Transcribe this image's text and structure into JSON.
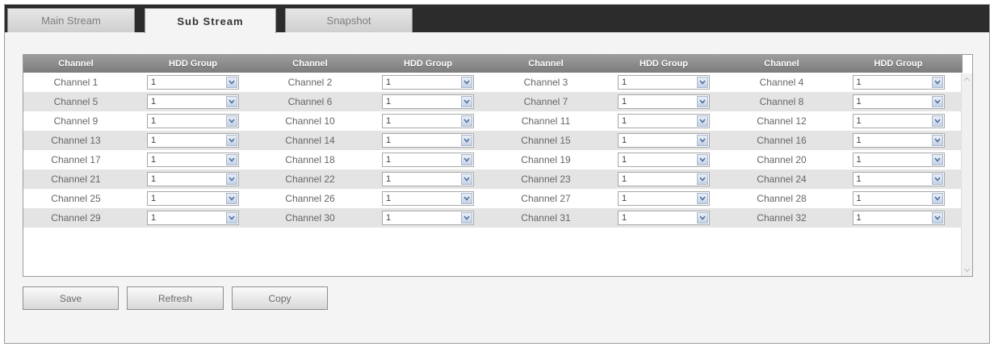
{
  "tabs": [
    {
      "label": "Main Stream"
    },
    {
      "label": "Sub Stream"
    },
    {
      "label": "Snapshot"
    }
  ],
  "table": {
    "headers": [
      "Channel",
      "HDD Group",
      "Channel",
      "HDD Group",
      "Channel",
      "HDD Group",
      "Channel",
      "HDD Group"
    ],
    "rows": [
      [
        {
          "ch": "Channel 1",
          "hdd": "1"
        },
        {
          "ch": "Channel 2",
          "hdd": "1"
        },
        {
          "ch": "Channel 3",
          "hdd": "1"
        },
        {
          "ch": "Channel 4",
          "hdd": "1"
        }
      ],
      [
        {
          "ch": "Channel 5",
          "hdd": "1"
        },
        {
          "ch": "Channel 6",
          "hdd": "1"
        },
        {
          "ch": "Channel 7",
          "hdd": "1"
        },
        {
          "ch": "Channel 8",
          "hdd": "1"
        }
      ],
      [
        {
          "ch": "Channel 9",
          "hdd": "1"
        },
        {
          "ch": "Channel 10",
          "hdd": "1"
        },
        {
          "ch": "Channel 11",
          "hdd": "1"
        },
        {
          "ch": "Channel 12",
          "hdd": "1"
        }
      ],
      [
        {
          "ch": "Channel 13",
          "hdd": "1"
        },
        {
          "ch": "Channel 14",
          "hdd": "1"
        },
        {
          "ch": "Channel 15",
          "hdd": "1"
        },
        {
          "ch": "Channel 16",
          "hdd": "1"
        }
      ],
      [
        {
          "ch": "Channel 17",
          "hdd": "1"
        },
        {
          "ch": "Channel 18",
          "hdd": "1"
        },
        {
          "ch": "Channel 19",
          "hdd": "1"
        },
        {
          "ch": "Channel 20",
          "hdd": "1"
        }
      ],
      [
        {
          "ch": "Channel 21",
          "hdd": "1"
        },
        {
          "ch": "Channel 22",
          "hdd": "1"
        },
        {
          "ch": "Channel 23",
          "hdd": "1"
        },
        {
          "ch": "Channel 24",
          "hdd": "1"
        }
      ],
      [
        {
          "ch": "Channel 25",
          "hdd": "1"
        },
        {
          "ch": "Channel 26",
          "hdd": "1"
        },
        {
          "ch": "Channel 27",
          "hdd": "1"
        },
        {
          "ch": "Channel 28",
          "hdd": "1"
        }
      ],
      [
        {
          "ch": "Channel 29",
          "hdd": "1"
        },
        {
          "ch": "Channel 30",
          "hdd": "1"
        },
        {
          "ch": "Channel 31",
          "hdd": "1"
        },
        {
          "ch": "Channel 32",
          "hdd": "1"
        }
      ]
    ]
  },
  "buttons": {
    "save": "Save",
    "refresh": "Refresh",
    "copy": "Copy"
  },
  "icons": {
    "dropdown": "chevron-down-icon",
    "scroll_up": "scroll-up-icon",
    "scroll_down": "scroll-down-icon"
  },
  "colors": {
    "tabbar": "#2c2c2c",
    "header": "#8c8c8c",
    "row_alt": "#e4e4e4",
    "dropdown_arrow": "#c4d2e6"
  }
}
